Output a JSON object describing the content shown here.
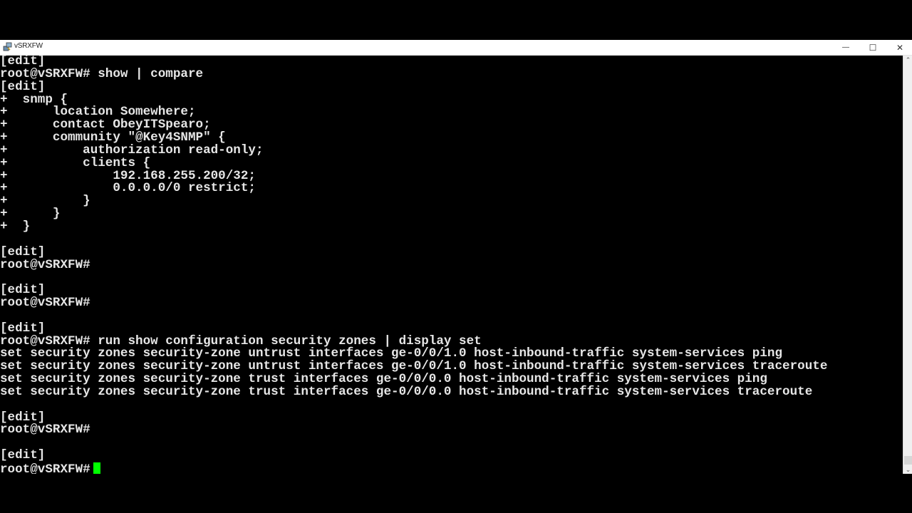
{
  "window": {
    "title": "vSRXFW",
    "icon": "putty-terminal-icon",
    "controls": {
      "minimize": "—",
      "maximize": "☐",
      "close": "✕"
    }
  },
  "terminal": {
    "prompt": "root@vSRXFW#",
    "cursor_color": "#00ff00",
    "lines": [
      "[edit]",
      "root@vSRXFW# show | compare",
      "[edit]",
      "+  snmp {",
      "+      location Somewhere;",
      "+      contact ObeyITSpearo;",
      "+      community \"@Key4SNMP\" {",
      "+          authorization read-only;",
      "+          clients {",
      "+              192.168.255.200/32;",
      "+              0.0.0.0/0 restrict;",
      "+          }",
      "+      }",
      "+  }",
      "",
      "[edit]",
      "root@vSRXFW#",
      "",
      "[edit]",
      "root@vSRXFW#",
      "",
      "[edit]",
      "root@vSRXFW# run show configuration security zones | display set",
      "set security zones security-zone untrust interfaces ge-0/0/1.0 host-inbound-traffic system-services ping",
      "set security zones security-zone untrust interfaces ge-0/0/1.0 host-inbound-traffic system-services traceroute",
      "set security zones security-zone trust interfaces ge-0/0/0.0 host-inbound-traffic system-services ping",
      "set security zones security-zone trust interfaces ge-0/0/0.0 host-inbound-traffic system-services traceroute",
      "",
      "[edit]",
      "root@vSRXFW#",
      "",
      "[edit]"
    ],
    "current_prompt": "root@vSRXFW#"
  },
  "scrollbar": {
    "up": "⌃",
    "down": "⌄"
  }
}
